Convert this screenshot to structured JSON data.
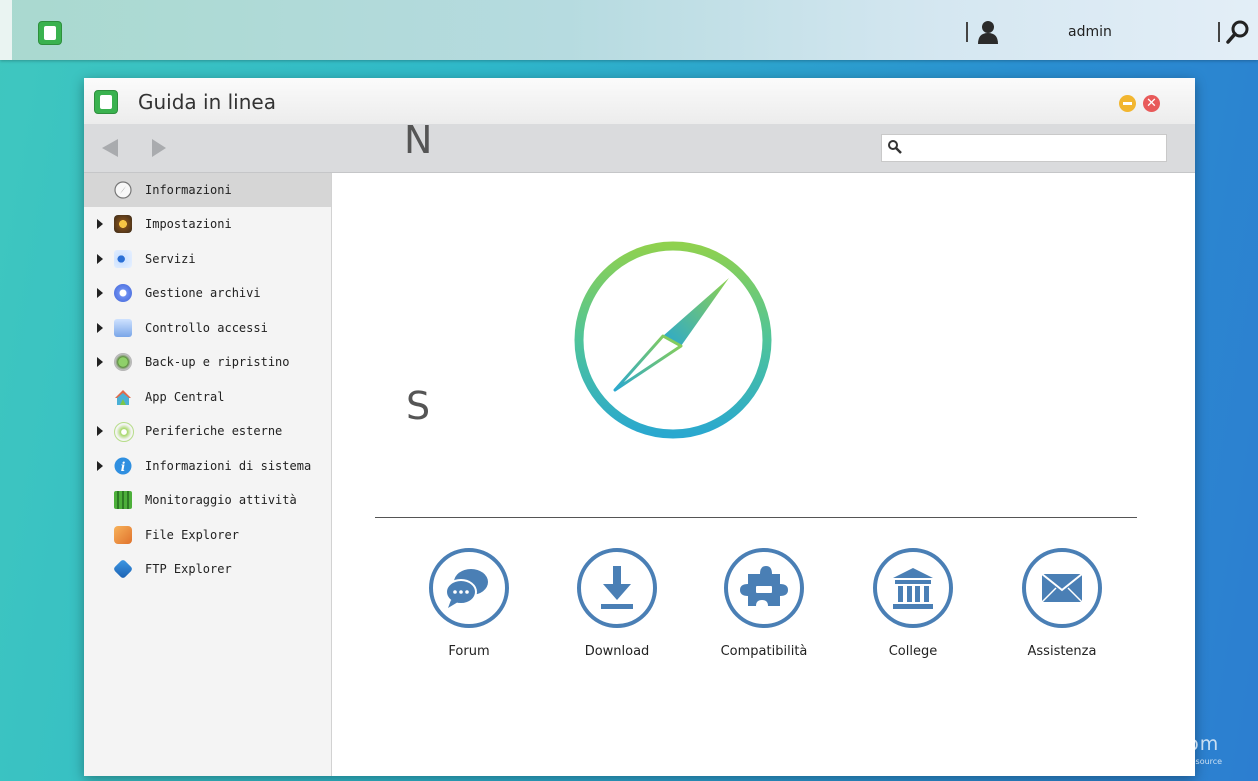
{
  "taskbar": {
    "user": "admin",
    "icons": [
      "app-launcher-icon",
      "user-icon",
      "search-icon"
    ]
  },
  "window": {
    "title": "Guida in linea",
    "controls": [
      "minimize-icon",
      "close-icon"
    ],
    "close_glyph": "✕"
  },
  "search": {
    "placeholder": "",
    "value": ""
  },
  "sidebar": {
    "items": [
      {
        "label": "Informazioni",
        "expandable": false,
        "selected": true,
        "icon": "compass-icon"
      },
      {
        "label": "Impostazioni",
        "expandable": true,
        "icon": "settings-icon"
      },
      {
        "label": "Servizi",
        "expandable": true,
        "icon": "services-icon"
      },
      {
        "label": "Gestione archivi",
        "expandable": true,
        "icon": "storage-icon"
      },
      {
        "label": "Controllo accessi",
        "expandable": true,
        "icon": "access-icon"
      },
      {
        "label": "Back-up e ripristino",
        "expandable": true,
        "icon": "backup-icon"
      },
      {
        "label": "App Central",
        "expandable": false,
        "icon": "app-central-icon"
      },
      {
        "label": "Periferiche esterne",
        "expandable": true,
        "icon": "external-devices-icon"
      },
      {
        "label": "Informazioni di sistema",
        "expandable": true,
        "icon": "info-icon"
      },
      {
        "label": "Monitoraggio attività",
        "expandable": false,
        "icon": "monitor-icon"
      },
      {
        "label": "File Explorer",
        "expandable": false,
        "icon": "file-explorer-icon"
      },
      {
        "label": "FTP Explorer",
        "expandable": false,
        "icon": "ftp-explorer-icon"
      }
    ]
  },
  "main": {
    "compass_north": "N",
    "compass_south": "S",
    "links": [
      {
        "label": "Forum",
        "icon": "forum-icon"
      },
      {
        "label": "Download",
        "icon": "download-icon"
      },
      {
        "label": "Compatibilità",
        "icon": "compatibility-icon"
      },
      {
        "label": "College",
        "icon": "college-icon"
      },
      {
        "label": "Assistenza",
        "icon": "support-icon"
      }
    ]
  },
  "watermark": {
    "text": "nexthardware.com",
    "tagline": "your ultimate professional resource"
  },
  "colors": {
    "accent_blue": "#4a7fb5",
    "compass_green": "#6cc24a",
    "compass_teal": "#2fb0c8"
  }
}
